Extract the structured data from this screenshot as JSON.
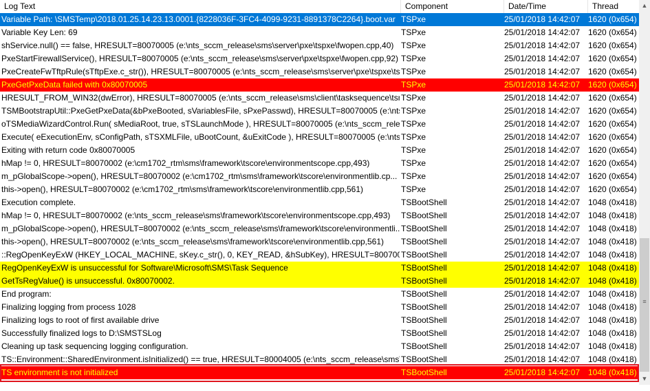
{
  "columns": {
    "log_text": "Log Text",
    "component": "Component",
    "datetime": "Date/Time",
    "thread": "Thread"
  },
  "rows": [
    {
      "text": "Variable Path: \\SMSTemp\\2018.01.25.14.23.13.0001.{8228036F-3FC4-4099-9231-8891378C2264}.boot.var",
      "component": "TSPxe",
      "datetime": "25/01/2018 14:42:07",
      "thread": "1620 (0x654)",
      "state": "selected"
    },
    {
      "text": "Variable Key Len: 69",
      "component": "TSPxe",
      "datetime": "25/01/2018 14:42:07",
      "thread": "1620 (0x654)",
      "state": "normal"
    },
    {
      "text": "shService.null() == false, HRESULT=80070005 (e:\\nts_sccm_release\\sms\\server\\pxe\\tspxe\\fwopen.cpp,40)",
      "component": "TSPxe",
      "datetime": "25/01/2018 14:42:07",
      "thread": "1620 (0x654)",
      "state": "normal"
    },
    {
      "text": "PxeStartFirewallService(), HRESULT=80070005 (e:\\nts_sccm_release\\sms\\server\\pxe\\tspxe\\fwopen.cpp,92)",
      "component": "TSPxe",
      "datetime": "25/01/2018 14:42:07",
      "thread": "1620 (0x654)",
      "state": "normal"
    },
    {
      "text": "PxeCreateFwTftpRule(sTftpExe.c_str()), HRESULT=80070005 (e:\\nts_sccm_release\\sms\\server\\pxe\\tspxe\\tspx...",
      "component": "TSPxe",
      "datetime": "25/01/2018 14:42:07",
      "thread": "1620 (0x654)",
      "state": "normal"
    },
    {
      "text": "PxeGetPxeData failed with 0x80070005",
      "component": "TSPxe",
      "datetime": "25/01/2018 14:42:07",
      "thread": "1620 (0x654)",
      "state": "error"
    },
    {
      "text": "HRESULT_FROM_WIN32(dwError), HRESULT=80070005 (e:\\nts_sccm_release\\sms\\client\\tasksequence\\tsmb...",
      "component": "TSPxe",
      "datetime": "25/01/2018 14:42:07",
      "thread": "1620 (0x654)",
      "state": "normal"
    },
    {
      "text": "TSMBootstrapUtil::PxeGetPxeData(&bPxeBooted, sVariablesFile, sPxePasswd), HRESULT=80070005 (e:\\nts_sc...",
      "component": "TSPxe",
      "datetime": "25/01/2018 14:42:07",
      "thread": "1620 (0x654)",
      "state": "normal"
    },
    {
      "text": "oTSMediaWizardControl.Run( sMediaRoot, true, sTSLaunchMode ), HRESULT=80070005 (e:\\nts_sccm_relea...",
      "component": "TSPxe",
      "datetime": "25/01/2018 14:42:07",
      "thread": "1620 (0x654)",
      "state": "normal"
    },
    {
      "text": "Execute( eExecutionEnv, sConfigPath, sTSXMLFile, uBootCount, &uExitCode ), HRESULT=80070005 (e:\\nts_s...",
      "component": "TSPxe",
      "datetime": "25/01/2018 14:42:07",
      "thread": "1620 (0x654)",
      "state": "normal"
    },
    {
      "text": "Exiting with return code 0x80070005",
      "component": "TSPxe",
      "datetime": "25/01/2018 14:42:07",
      "thread": "1620 (0x654)",
      "state": "normal"
    },
    {
      "text": "hMap != 0, HRESULT=80070002 (e:\\cm1702_rtm\\sms\\framework\\tscore\\environmentscope.cpp,493)",
      "component": "TSPxe",
      "datetime": "25/01/2018 14:42:07",
      "thread": "1620 (0x654)",
      "state": "normal"
    },
    {
      "text": "m_pGlobalScope->open(), HRESULT=80070002 (e:\\cm1702_rtm\\sms\\framework\\tscore\\environmentlib.cp...",
      "component": "TSPxe",
      "datetime": "25/01/2018 14:42:07",
      "thread": "1620 (0x654)",
      "state": "normal"
    },
    {
      "text": "this->open(), HRESULT=80070002 (e:\\cm1702_rtm\\sms\\framework\\tscore\\environmentlib.cpp,561)",
      "component": "TSPxe",
      "datetime": "25/01/2018 14:42:07",
      "thread": "1620 (0x654)",
      "state": "normal"
    },
    {
      "text": "Execution complete.",
      "component": "TSBootShell",
      "datetime": "25/01/2018 14:42:07",
      "thread": "1048 (0x418)",
      "state": "normal"
    },
    {
      "text": "hMap != 0, HRESULT=80070002 (e:\\nts_sccm_release\\sms\\framework\\tscore\\environmentscope.cpp,493)",
      "component": "TSBootShell",
      "datetime": "25/01/2018 14:42:07",
      "thread": "1048 (0x418)",
      "state": "normal"
    },
    {
      "text": "m_pGlobalScope->open(), HRESULT=80070002 (e:\\nts_sccm_release\\sms\\framework\\tscore\\environmentli...",
      "component": "TSBootShell",
      "datetime": "25/01/2018 14:42:07",
      "thread": "1048 (0x418)",
      "state": "normal"
    },
    {
      "text": "this->open(), HRESULT=80070002 (e:\\nts_sccm_release\\sms\\framework\\tscore\\environmentlib.cpp,561)",
      "component": "TSBootShell",
      "datetime": "25/01/2018 14:42:07",
      "thread": "1048 (0x418)",
      "state": "normal"
    },
    {
      "text": "::RegOpenKeyExW (HKEY_LOCAL_MACHINE, sKey.c_str(), 0, KEY_READ, &hSubKey), HRESULT=80070002 (e:\\...",
      "component": "TSBootShell",
      "datetime": "25/01/2018 14:42:07",
      "thread": "1048 (0x418)",
      "state": "normal"
    },
    {
      "text": "RegOpenKeyExW is unsuccessful for Software\\Microsoft\\SMS\\Task Sequence",
      "component": "TSBootShell",
      "datetime": "25/01/2018 14:42:07",
      "thread": "1048 (0x418)",
      "state": "warning"
    },
    {
      "text": "GetTsRegValue() is unsuccessful. 0x80070002.",
      "component": "TSBootShell",
      "datetime": "25/01/2018 14:42:07",
      "thread": "1048 (0x418)",
      "state": "warning"
    },
    {
      "text": "End program:",
      "component": "TSBootShell",
      "datetime": "25/01/2018 14:42:07",
      "thread": "1048 (0x418)",
      "state": "normal"
    },
    {
      "text": "Finalizing logging from process 1028",
      "component": "TSBootShell",
      "datetime": "25/01/2018 14:42:07",
      "thread": "1048 (0x418)",
      "state": "normal"
    },
    {
      "text": "Finalizing logs to root of first available drive",
      "component": "TSBootShell",
      "datetime": "25/01/2018 14:42:07",
      "thread": "1048 (0x418)",
      "state": "normal"
    },
    {
      "text": "Successfully finalized logs to D:\\SMSTSLog",
      "component": "TSBootShell",
      "datetime": "25/01/2018 14:42:07",
      "thread": "1048 (0x418)",
      "state": "normal"
    },
    {
      "text": "Cleaning up task sequencing logging configuration.",
      "component": "TSBootShell",
      "datetime": "25/01/2018 14:42:07",
      "thread": "1048 (0x418)",
      "state": "normal"
    },
    {
      "text": "TS::Environment::SharedEnvironment.isInitialized() == true, HRESULT=80004005 (e:\\nts_sccm_release\\sms\\f...",
      "component": "TSBootShell",
      "datetime": "25/01/2018 14:42:07",
      "thread": "1048 (0x418)",
      "state": "normal"
    },
    {
      "text": "TS environment is not initialized",
      "component": "TSBootShell",
      "datetime": "25/01/2018 14:42:07",
      "thread": "1048 (0x418)",
      "state": "error"
    }
  ],
  "colors": {
    "selected_bg": "#0078d7",
    "error_bg": "#ff0000",
    "error_text": "#ffff00",
    "warning_bg": "#ffff00",
    "highlight_border": "#e0141e"
  },
  "icons": {
    "scroll_up": "chevron-up-icon",
    "scroll_down": "chevron-down-icon",
    "thumb_grip": "grip-lines-icon"
  }
}
